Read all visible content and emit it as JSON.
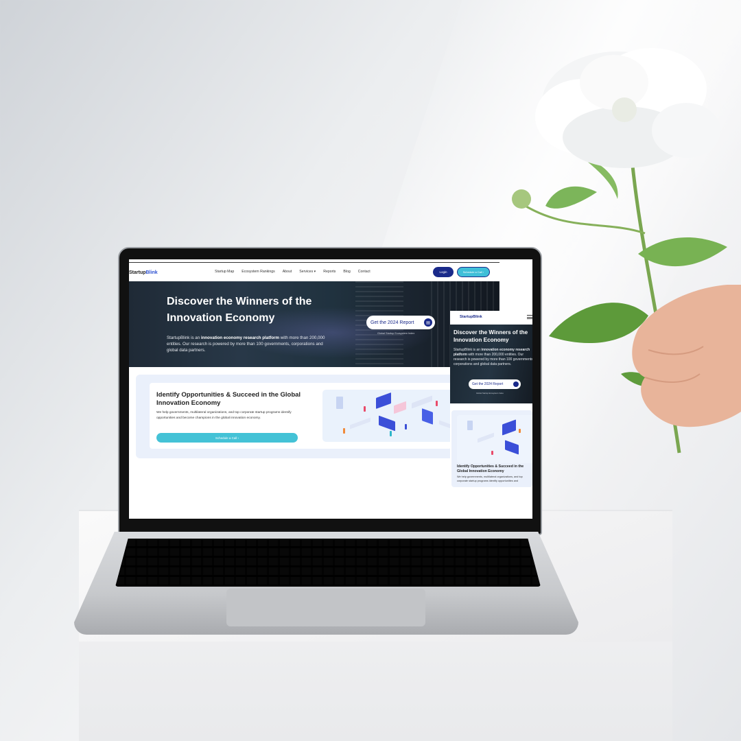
{
  "desktop": {
    "logo": {
      "part1": "Startup",
      "part2": "Blink"
    },
    "nav": {
      "items": [
        "Startup Map",
        "Ecosystem Rankings",
        "About",
        "Services",
        "Reports",
        "Blog",
        "Contact"
      ],
      "services_caret": "▾",
      "login_label": "Login",
      "schedule_label": "Schedule a Call ›"
    },
    "hero": {
      "title": "Discover the Winners of the Innovation Economy",
      "desc_prefix": "StartupBlink is an ",
      "desc_bold": "innovation economy research platform",
      "desc_suffix": " with more than 200,000 entities. Our research is powered by more than 100 governments, corporations and global data partners.",
      "report_button": "Get the 2024 Report",
      "report_sub": "Global Startup Ecosystem Index"
    },
    "section": {
      "title": "Identify Opportunities & Succeed in the Global Innovation Economy",
      "desc": "We help governments, multilateral organizations, and top corporate startup programs identify opportunities and become champions in the global innovation economy.",
      "cta": "Schedule a Call ›"
    }
  },
  "mobile": {
    "logo": "StartupBlink",
    "hero": {
      "title": "Discover the Winners of the Innovation Economy",
      "desc_prefix": "StartupBlink is an ",
      "desc_bold": "innovation economy research platform",
      "desc_suffix": " with more than 200,000 entities. Our research is powered by more than 100 governments, corporations and global data partners.",
      "report_button": "Get the 2024 Report",
      "report_sub": "Global Startup Ecosystem Index"
    },
    "section": {
      "title": "Identify Opportunities & Succeed in the Global Innovation Economy",
      "desc": "We help governments, multilateral organizations, and top corporate startup programs identify opportunities and"
    }
  },
  "colors": {
    "brand_navy": "#1a2a8a",
    "accent_cyan": "#44c2d6",
    "section_bg": "#eaf0fb"
  }
}
